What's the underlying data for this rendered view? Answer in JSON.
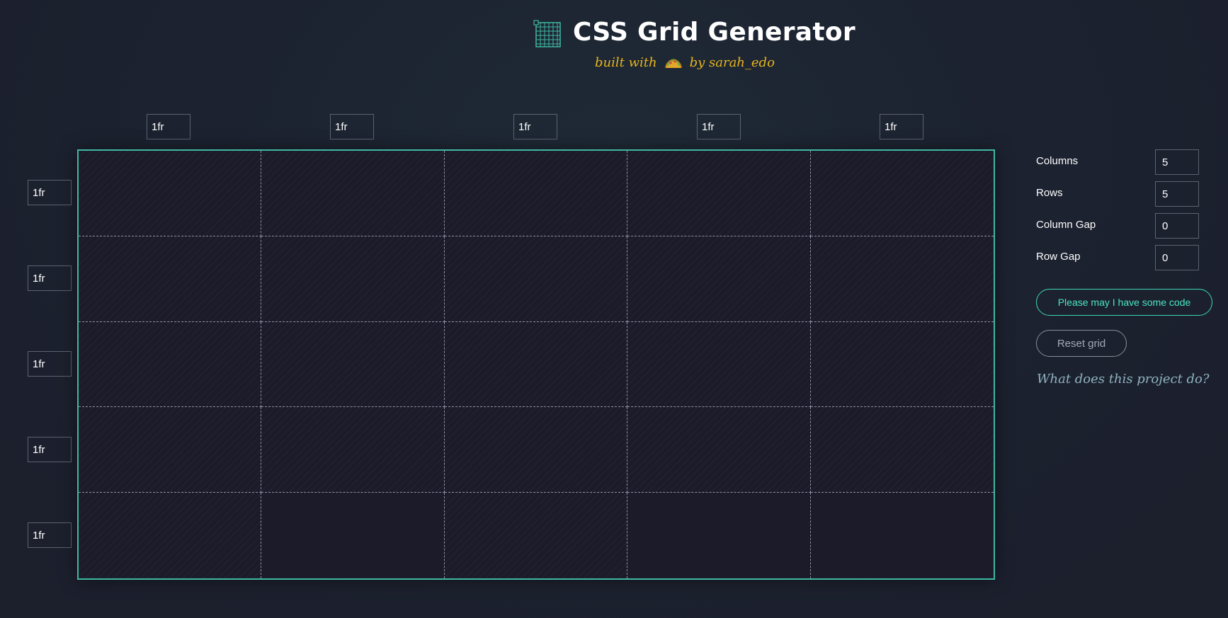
{
  "header": {
    "title": "CSS Grid Generator",
    "subtitle_prefix": "built with",
    "subtitle_suffix": "by sarah_edo",
    "logo_icon": "grid-logo-icon",
    "subtitle_icon": "taco-icon"
  },
  "column_tracks": [
    "1fr",
    "1fr",
    "1fr",
    "1fr",
    "1fr"
  ],
  "row_tracks": [
    "1fr",
    "1fr",
    "1fr",
    "1fr",
    "1fr"
  ],
  "settings": {
    "columns_label": "Columns",
    "columns_value": "5",
    "rows_label": "Rows",
    "rows_value": "5",
    "column_gap_label": "Column Gap",
    "column_gap_value": "0",
    "row_gap_label": "Row Gap",
    "row_gap_value": "0"
  },
  "actions": {
    "code_button": "Please may I have some code",
    "reset_button": "Reset grid",
    "about_link": "What does this project do?"
  },
  "colors": {
    "accent": "#3fb8a3",
    "button_accent": "#48e6c5",
    "subtitle": "#e7b51d",
    "background": "#1c2230"
  }
}
